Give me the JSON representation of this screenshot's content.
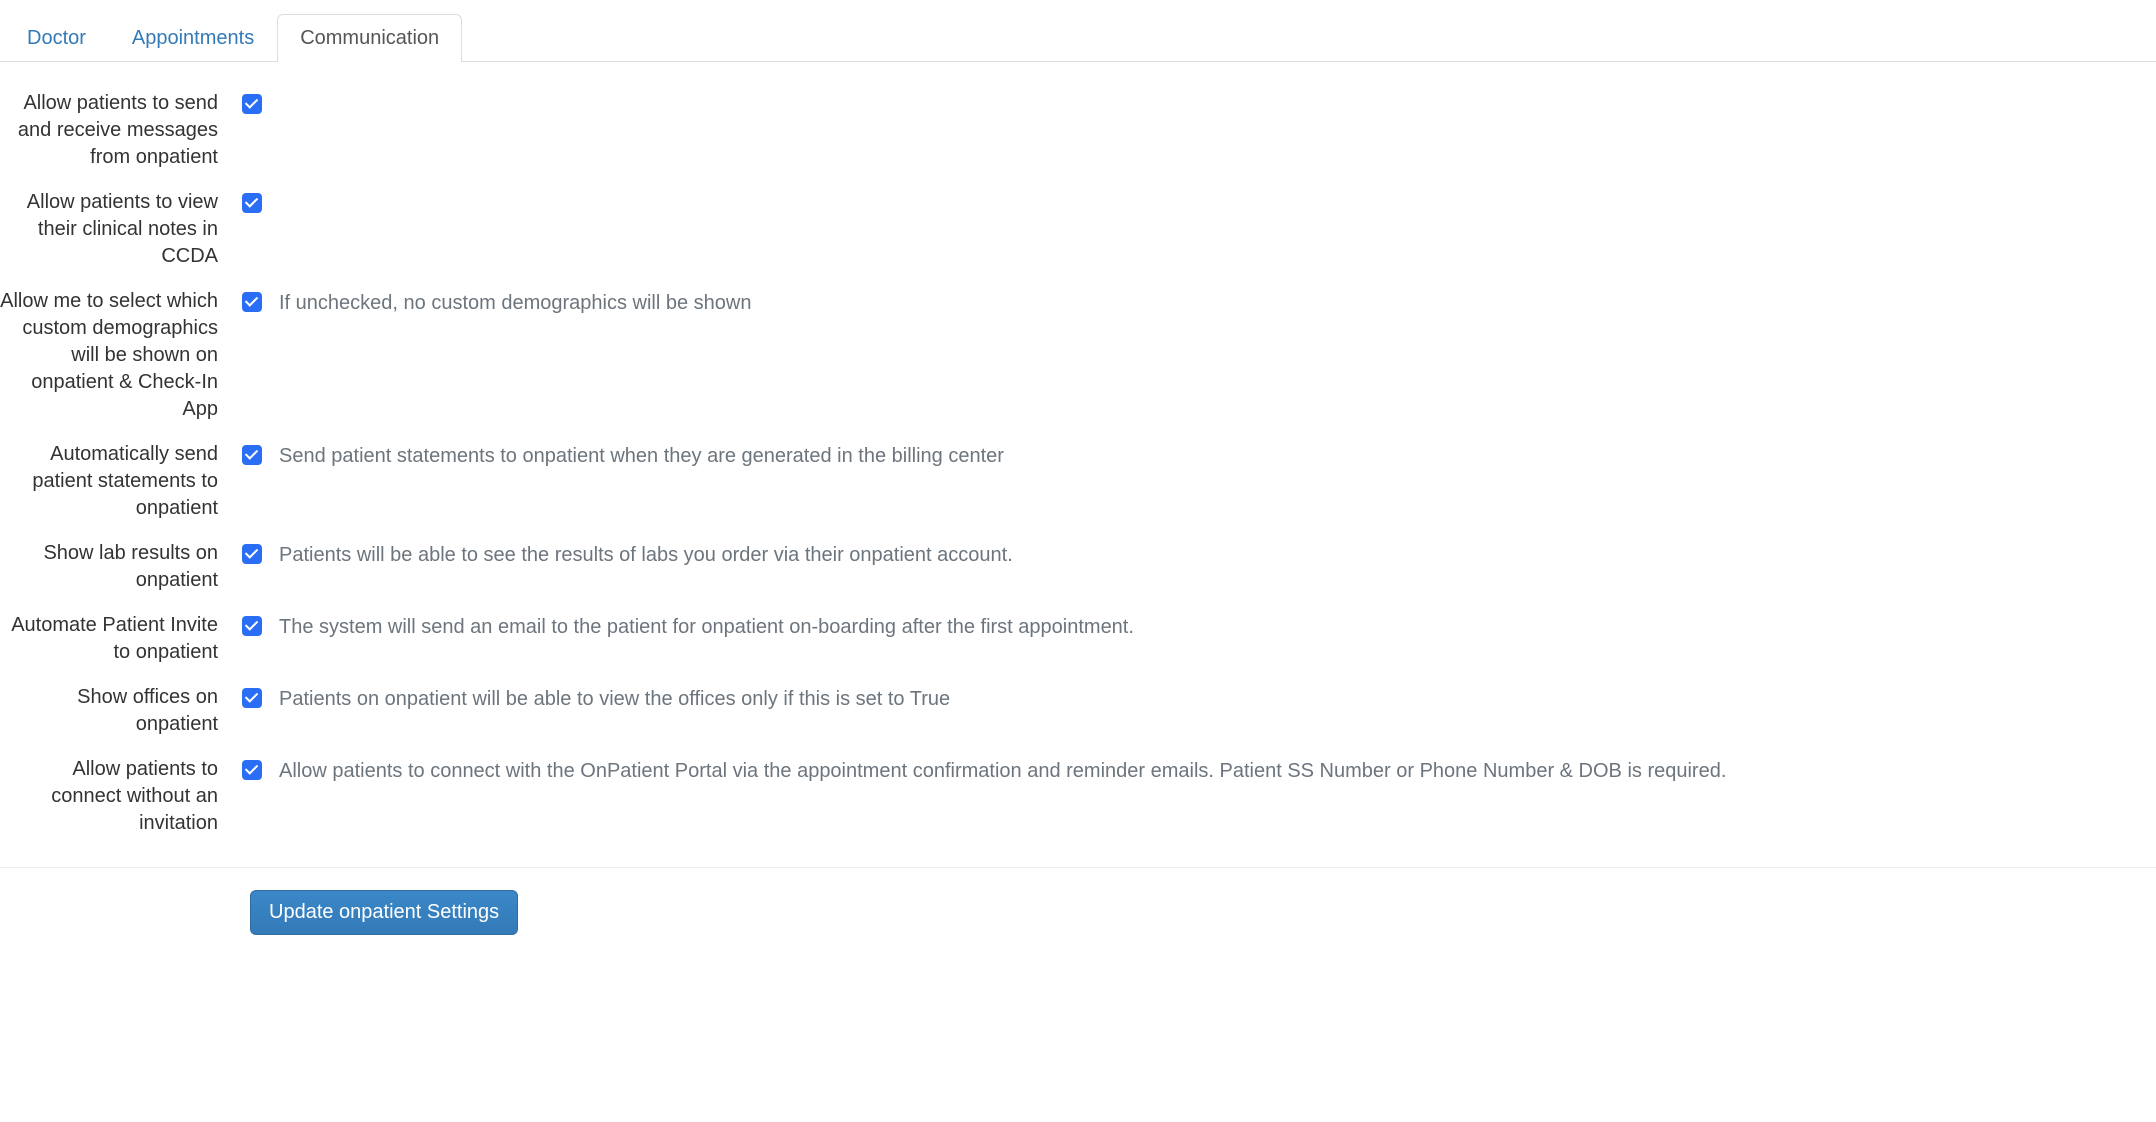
{
  "tabs": {
    "doctor": "Doctor",
    "appointments": "Appointments",
    "communication": "Communication"
  },
  "settings": {
    "messages": {
      "label": "Allow patients to send and receive messages from onpatient",
      "checked": true
    },
    "ccda": {
      "label": "Allow patients to view their clinical notes in CCDA",
      "checked": true
    },
    "demographics": {
      "label": "Allow me to select which custom demographics will be shown on onpatient & Check-In App",
      "checked": true,
      "help": "If unchecked, no custom demographics will be shown"
    },
    "statements": {
      "label": "Automatically send patient statements to onpatient",
      "checked": true,
      "help": "Send patient statements to onpatient when they are generated in the billing center"
    },
    "labs": {
      "label": "Show lab results on onpatient",
      "checked": true,
      "help": "Patients will be able to see the results of labs you order via their onpatient account."
    },
    "invite": {
      "label": "Automate Patient Invite to onpatient",
      "checked": true,
      "help": "The system will send an email to the patient for onpatient on-boarding after the first appointment."
    },
    "offices": {
      "label": "Show offices on onpatient",
      "checked": true,
      "help": "Patients on onpatient will be able to view the offices only if this is set to True"
    },
    "connect_no_invite": {
      "label": "Allow patients to connect without an invitation",
      "checked": true,
      "help": "Allow patients to connect with the OnPatient Portal via the appointment confirmation and reminder emails. Patient SS Number or Phone Number & DOB is required."
    }
  },
  "footer": {
    "update_button": "Update onpatient Settings"
  }
}
